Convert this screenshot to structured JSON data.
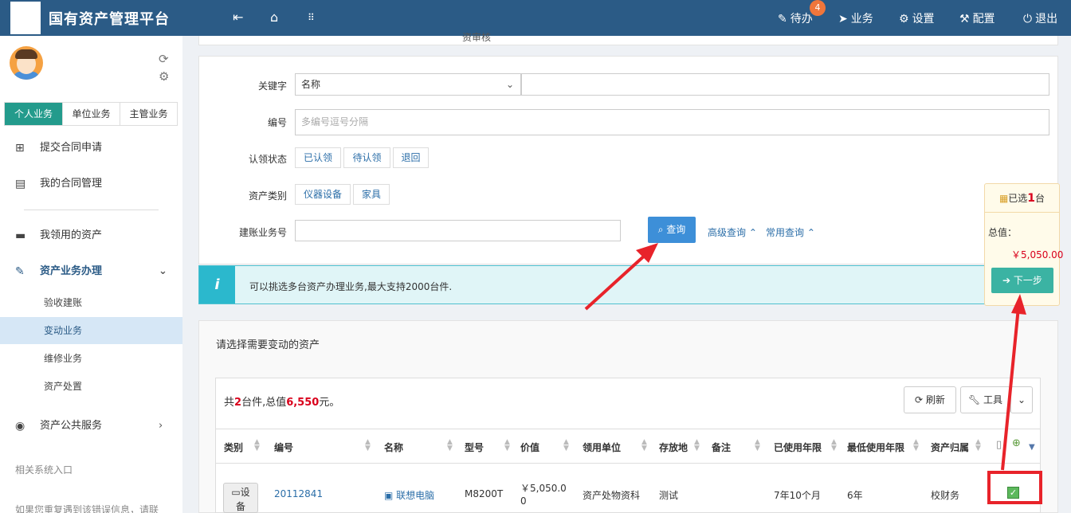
{
  "header": {
    "app_title": "国有资产管理平台",
    "todo_label": "待办",
    "todo_badge": "4",
    "business_label": "业务",
    "settings_label": "设置",
    "config_label": "配置",
    "logout_label": "退出"
  },
  "sidebar": {
    "tabs": [
      "个人业务",
      "单位业务",
      "主管业务"
    ],
    "items": {
      "submit_contract": "提交合同申请",
      "my_contracts": "我的合同管理",
      "my_assets": "我领用的资产",
      "asset_business": "资产业务办理",
      "public_service": "资产公共服务"
    },
    "sub_items": [
      "验收建账",
      "变动业务",
      "维修业务",
      "资产处置"
    ],
    "related_entry": "相关系统入口",
    "bottom_note": "如果您重复遇到该错误信息，请联"
  },
  "breadcrumb_fragment": "资审核",
  "search": {
    "keyword_label": "关键字",
    "keyword_select": "名称",
    "number_label": "编号",
    "number_placeholder": "多编号逗号分隔",
    "claim_label": "认领状态",
    "claim_options": [
      "已认领",
      "待认领",
      "退回"
    ],
    "category_label": "资产类别",
    "category_options": [
      "仪器设备",
      "家具"
    ],
    "account_label": "建账业务号",
    "query_button": "查询",
    "advanced_query": "高级查询",
    "common_query": "常用查询"
  },
  "info": {
    "icon": "i",
    "text": "可以挑选多台资产办理业务,最大支持2000台件."
  },
  "list": {
    "section_title": "请选择需要变动的资产",
    "summary_prefix": "共",
    "summary_count": "2",
    "summary_mid": "台件,总值",
    "summary_total": "6,550",
    "summary_suffix": "元。",
    "refresh_button": "刷新",
    "tools_button": "工具",
    "columns": [
      "类别",
      "编号",
      "名称",
      "型号",
      "价值",
      "领用单位",
      "存放地",
      "备注",
      "已使用年限",
      "最低使用年限",
      "资产归属"
    ],
    "rows": [
      {
        "category_line1": "设",
        "category_line2": "备",
        "number": "20112841",
        "name": "联想电脑",
        "model": "M8200T",
        "value_line1": "￥5,050.0",
        "value_line2": "0",
        "unit": "资产处物资科",
        "location": "测试",
        "remark": "",
        "used_years": "7年10个月",
        "min_years": "6年",
        "ownership": "校财务"
      }
    ]
  },
  "cart": {
    "selected_prefix": "已选",
    "selected_count": "1",
    "selected_suffix": "台",
    "total_label": "总值：",
    "total_value": "￥5,050.00",
    "next_button": "下一步"
  },
  "colors": {
    "header_bg": "#2b5b86",
    "active_tab": "#239b8c",
    "query_button": "#3d8fd8",
    "next_button": "#3bb3a3",
    "annotation_red": "#e8232a"
  }
}
